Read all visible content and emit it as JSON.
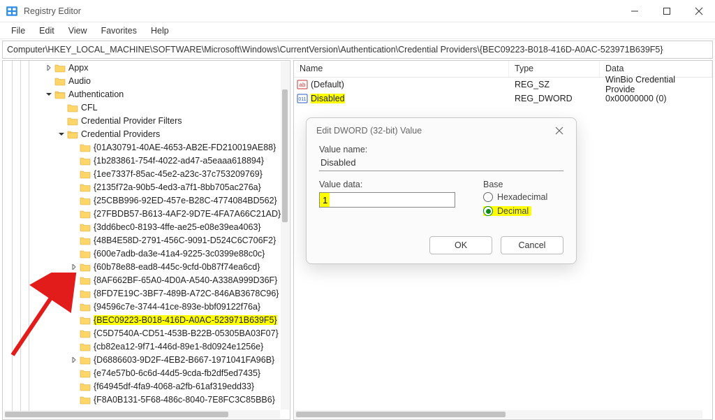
{
  "window": {
    "title": "Registry Editor"
  },
  "menubar": [
    "File",
    "Edit",
    "View",
    "Favorites",
    "Help"
  ],
  "address": "Computer\\HKEY_LOCAL_MACHINE\\SOFTWARE\\Microsoft\\Windows\\CurrentVersion\\Authentication\\Credential Providers\\{BEC09223-B018-416D-A0AC-523971B639F5}",
  "tree": {
    "items": [
      {
        "indent": 3,
        "arrow": "right",
        "label": "Appx"
      },
      {
        "indent": 3,
        "arrow": "",
        "label": "Audio"
      },
      {
        "indent": 3,
        "arrow": "down",
        "label": "Authentication"
      },
      {
        "indent": 4,
        "arrow": "",
        "label": "CFL"
      },
      {
        "indent": 4,
        "arrow": "",
        "label": "Credential Provider Filters"
      },
      {
        "indent": 4,
        "arrow": "down",
        "label": "Credential Providers"
      },
      {
        "indent": 5,
        "arrow": "",
        "label": "{01A30791-40AE-4653-AB2E-FD210019AE88}"
      },
      {
        "indent": 5,
        "arrow": "",
        "label": "{1b283861-754f-4022-ad47-a5eaaa618894}"
      },
      {
        "indent": 5,
        "arrow": "",
        "label": "{1ee7337f-85ac-45e2-a23c-37c753209769}"
      },
      {
        "indent": 5,
        "arrow": "",
        "label": "{2135f72a-90b5-4ed3-a7f1-8bb705ac276a}"
      },
      {
        "indent": 5,
        "arrow": "",
        "label": "{25CBB996-92ED-457e-B28C-4774084BD562}"
      },
      {
        "indent": 5,
        "arrow": "",
        "label": "{27FBDB57-B613-4AF2-9D7E-4FA7A66C21AD}"
      },
      {
        "indent": 5,
        "arrow": "",
        "label": "{3dd6bec0-8193-4ffe-ae25-e08e39ea4063}"
      },
      {
        "indent": 5,
        "arrow": "",
        "label": "{48B4E58D-2791-456C-9091-D524C6C706F2}"
      },
      {
        "indent": 5,
        "arrow": "",
        "label": "{600e7adb-da3e-41a4-9225-3c0399e88c0c}"
      },
      {
        "indent": 5,
        "arrow": "right",
        "label": "{60b78e88-ead8-445c-9cfd-0b87f74ea6cd}"
      },
      {
        "indent": 5,
        "arrow": "",
        "label": "{8AF662BF-65A0-4D0A-A540-A338A999D36F}"
      },
      {
        "indent": 5,
        "arrow": "",
        "label": "{8FD7E19C-3BF7-489B-A72C-846AB3678C96}"
      },
      {
        "indent": 5,
        "arrow": "",
        "label": "{94596c7e-3744-41ce-893e-bbf09122f76a}"
      },
      {
        "indent": 5,
        "arrow": "",
        "label": "{BEC09223-B018-416D-A0AC-523971B639F5}",
        "highlight": true,
        "selected": true
      },
      {
        "indent": 5,
        "arrow": "",
        "label": "{C5D7540A-CD51-453B-B22B-05305BA03F07}"
      },
      {
        "indent": 5,
        "arrow": "",
        "label": "{cb82ea12-9f71-446d-89e1-8d0924e1256e}"
      },
      {
        "indent": 5,
        "arrow": "right",
        "label": "{D6886603-9D2F-4EB2-B667-1971041FA96B}"
      },
      {
        "indent": 5,
        "arrow": "",
        "label": "{e74e57b0-6c6d-44d5-9cda-fb2df5ed7435}"
      },
      {
        "indent": 5,
        "arrow": "",
        "label": "{f64945df-4fa9-4068-a2fb-61af319edd33}"
      },
      {
        "indent": 5,
        "arrow": "",
        "label": "{F8A0B131-5F68-486c-8040-7E8FC3C85BB6}"
      }
    ]
  },
  "list": {
    "headers": {
      "name": "Name",
      "type": "Type",
      "data": "Data"
    },
    "rows": [
      {
        "icon": "string",
        "name": "(Default)",
        "type": "REG_SZ",
        "data": "WinBio Credential Provide",
        "highlight": false
      },
      {
        "icon": "binary",
        "name": "Disabled",
        "type": "REG_DWORD",
        "data": "0x00000000 (0)",
        "highlight": true
      }
    ]
  },
  "dialog": {
    "title": "Edit DWORD (32-bit) Value",
    "value_name_label": "Value name:",
    "value_name": "Disabled",
    "value_data_label": "Value data:",
    "value_data": "1",
    "base_label": "Base",
    "base_hex": "Hexadecimal",
    "base_dec": "Decimal",
    "ok": "OK",
    "cancel": "Cancel"
  }
}
